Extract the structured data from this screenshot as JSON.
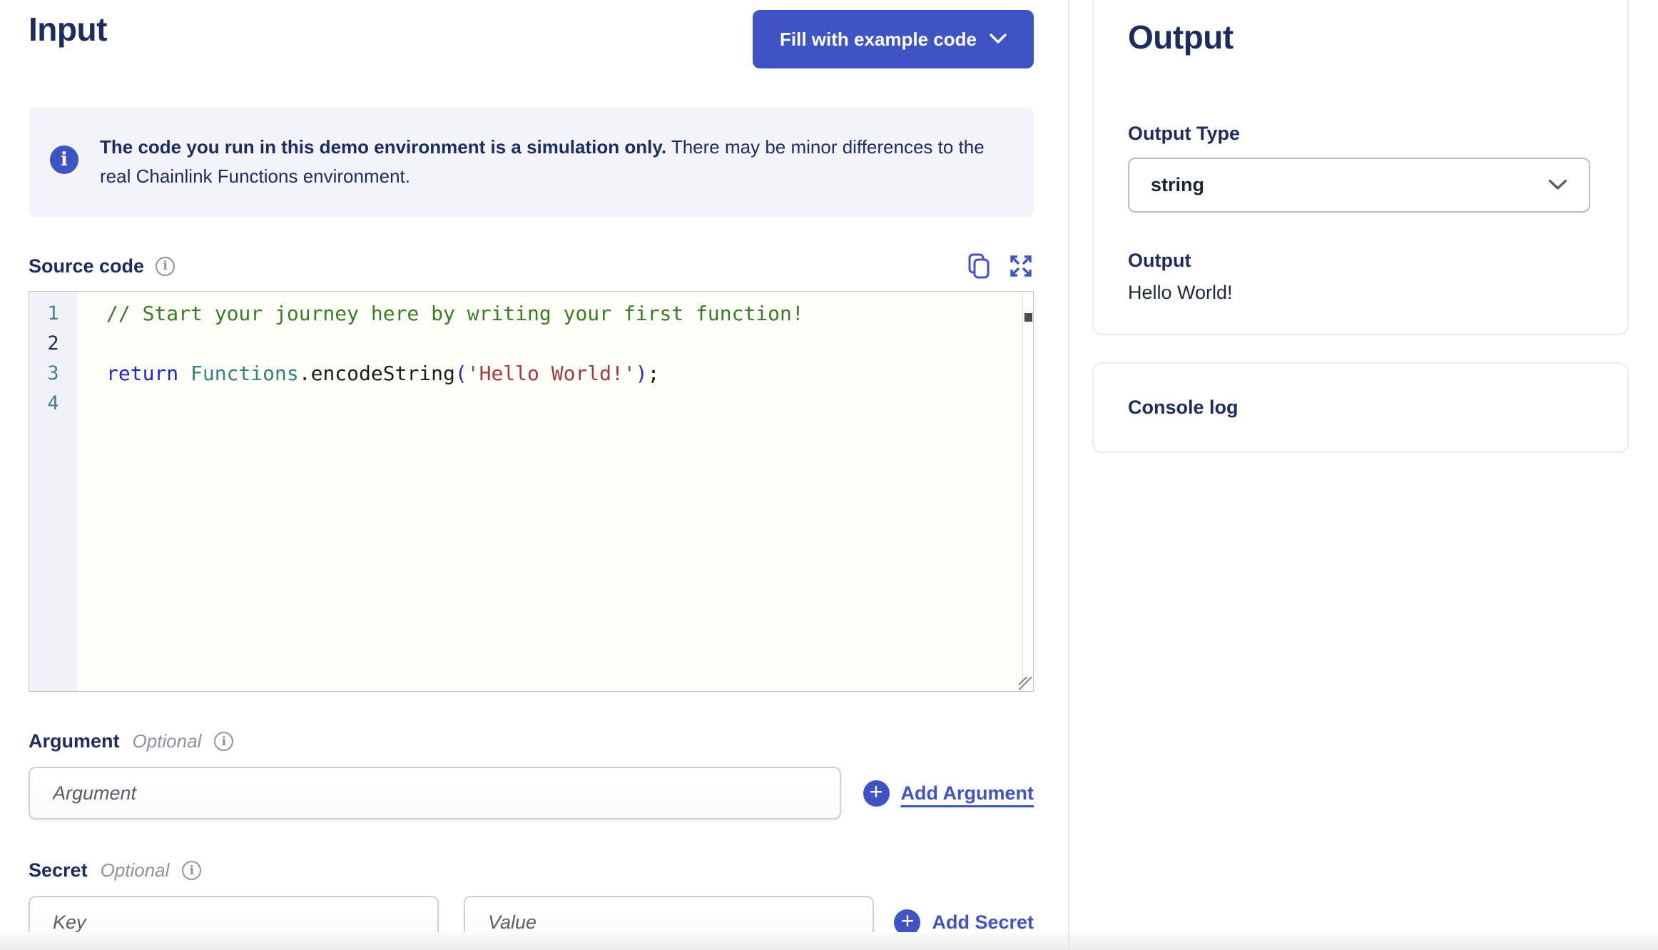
{
  "input_panel": {
    "title": "Input",
    "fill_button_label": "Fill with example code",
    "notice_bold": "The code you run in this demo environment is a simulation only.",
    "notice_rest": " There may be minor differences to the real Chainlink Functions environment.",
    "source_code": {
      "label": "Source code",
      "lines": [
        {
          "num": "1",
          "active": false,
          "tokens": [
            {
              "c": "comment",
              "t": "// Start your journey here by writing your first function!"
            }
          ]
        },
        {
          "num": "2",
          "active": true,
          "tokens": []
        },
        {
          "num": "3",
          "active": false,
          "tokens": [
            {
              "c": "keyword",
              "t": "return"
            },
            {
              "c": "plain",
              "t": " "
            },
            {
              "c": "variable",
              "t": "Functions"
            },
            {
              "c": "plain",
              "t": "."
            },
            {
              "c": "plain",
              "t": "encodeString"
            },
            {
              "c": "bracket",
              "t": "("
            },
            {
              "c": "string",
              "t": "'Hello World!'"
            },
            {
              "c": "bracket",
              "t": ")"
            },
            {
              "c": "plain",
              "t": ";"
            }
          ]
        },
        {
          "num": "4",
          "active": false,
          "tokens": []
        }
      ]
    },
    "argument": {
      "label": "Argument",
      "optional": "Optional",
      "placeholder": "Argument",
      "add_label": "Add Argument"
    },
    "secret": {
      "label": "Secret",
      "optional": "Optional",
      "key_placeholder": "Key",
      "value_placeholder": "Value",
      "add_label": "Add Secret"
    }
  },
  "output_panel": {
    "title": "Output",
    "output_type_label": "Output Type",
    "output_type_value": "string",
    "output_label": "Output",
    "output_value": "Hello World!",
    "console_label": "Console log"
  },
  "icons": {
    "banner_info": "info-icon",
    "copy": "copy-icon",
    "expand": "expand-icon",
    "chevron": "chevron-down-icon",
    "plus": "plus-circle-icon"
  },
  "colors": {
    "accent": "#3E54C5",
    "heading_navy": "#1D2B5F",
    "banner_bg": "#F3F4FA",
    "editor_bg": "#FFFFFA",
    "gutter_bg": "#F1F2F8",
    "code_comment": "#377D22",
    "code_keyword": "#2127CC",
    "code_variable": "#35807D",
    "code_string": "#A33B3B",
    "code_plain": "#1C1C1C",
    "line_number": "#4A7C9E",
    "line_number_active": "#1D2B5F"
  }
}
